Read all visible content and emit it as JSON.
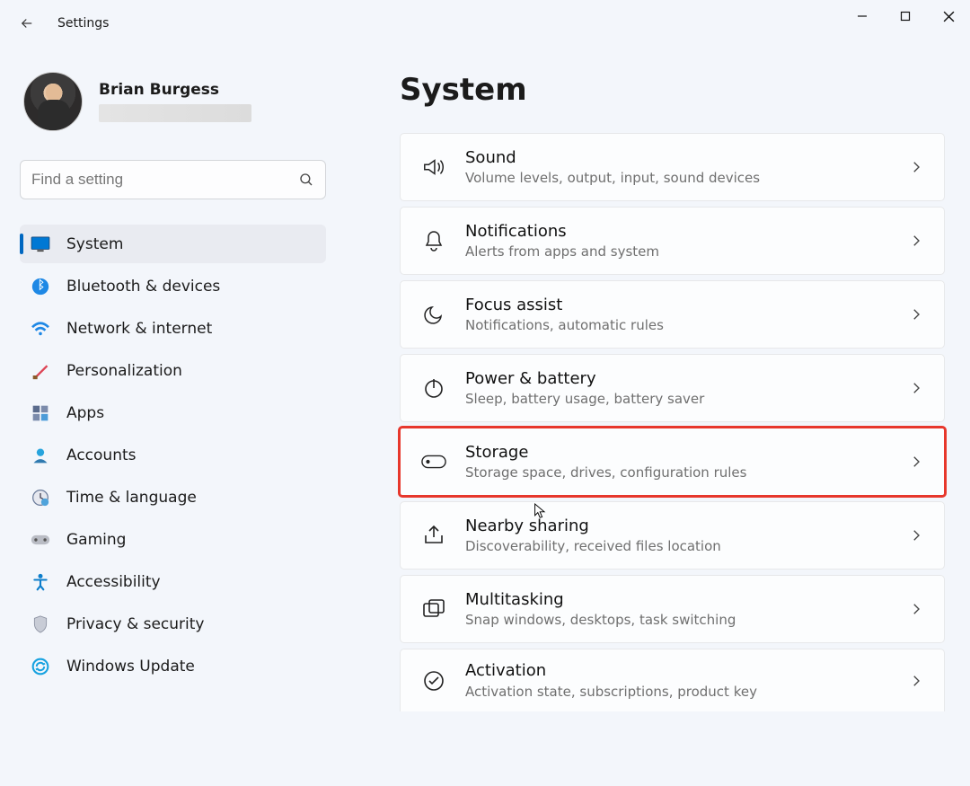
{
  "titlebar": {
    "title": "Settings"
  },
  "profile": {
    "name": "Brian Burgess"
  },
  "search": {
    "placeholder": "Find a setting"
  },
  "sidebar": {
    "items": [
      {
        "label": "System"
      },
      {
        "label": "Bluetooth & devices"
      },
      {
        "label": "Network & internet"
      },
      {
        "label": "Personalization"
      },
      {
        "label": "Apps"
      },
      {
        "label": "Accounts"
      },
      {
        "label": "Time & language"
      },
      {
        "label": "Gaming"
      },
      {
        "label": "Accessibility"
      },
      {
        "label": "Privacy & security"
      },
      {
        "label": "Windows Update"
      }
    ]
  },
  "page": {
    "title": "System"
  },
  "cards": [
    {
      "title": "Sound",
      "sub": "Volume levels, output, input, sound devices"
    },
    {
      "title": "Notifications",
      "sub": "Alerts from apps and system"
    },
    {
      "title": "Focus assist",
      "sub": "Notifications, automatic rules"
    },
    {
      "title": "Power & battery",
      "sub": "Sleep, battery usage, battery saver"
    },
    {
      "title": "Storage",
      "sub": "Storage space, drives, configuration rules"
    },
    {
      "title": "Nearby sharing",
      "sub": "Discoverability, received files location"
    },
    {
      "title": "Multitasking",
      "sub": "Snap windows, desktops, task switching"
    },
    {
      "title": "Activation",
      "sub": "Activation state, subscriptions, product key"
    }
  ]
}
